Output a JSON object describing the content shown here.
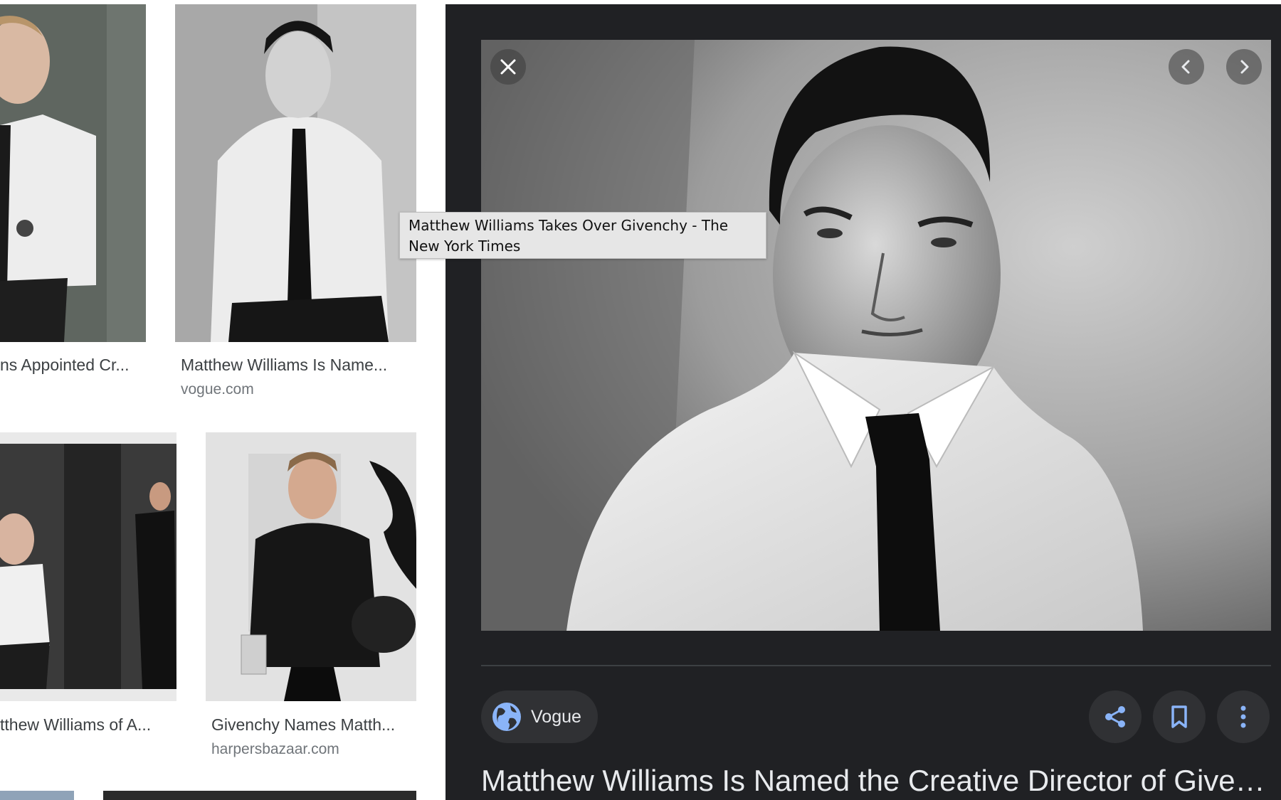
{
  "results": [
    {
      "title": "ns Appointed Cr...",
      "source": ""
    },
    {
      "title": "Matthew Williams Is Name...",
      "source": "vogue.com"
    },
    {
      "title": "tthew Williams of A...",
      "source": ""
    },
    {
      "title": "Givenchy Names Matth...",
      "source": "harpersbazaar.com"
    }
  ],
  "tooltip": {
    "text": "Matthew Williams Takes Over Givenchy - The New York Times"
  },
  "preview": {
    "source_label": "Vogue",
    "title": "Matthew Williams Is Named the Creative Director of Givenc...",
    "close_label": "Close",
    "prev_label": "Previous",
    "next_label": "Next",
    "share_label": "Share",
    "save_label": "Save",
    "more_label": "More"
  },
  "colors": {
    "panel_bg": "#202124",
    "accent": "#8ab4f8",
    "chip_bg": "#303134"
  }
}
